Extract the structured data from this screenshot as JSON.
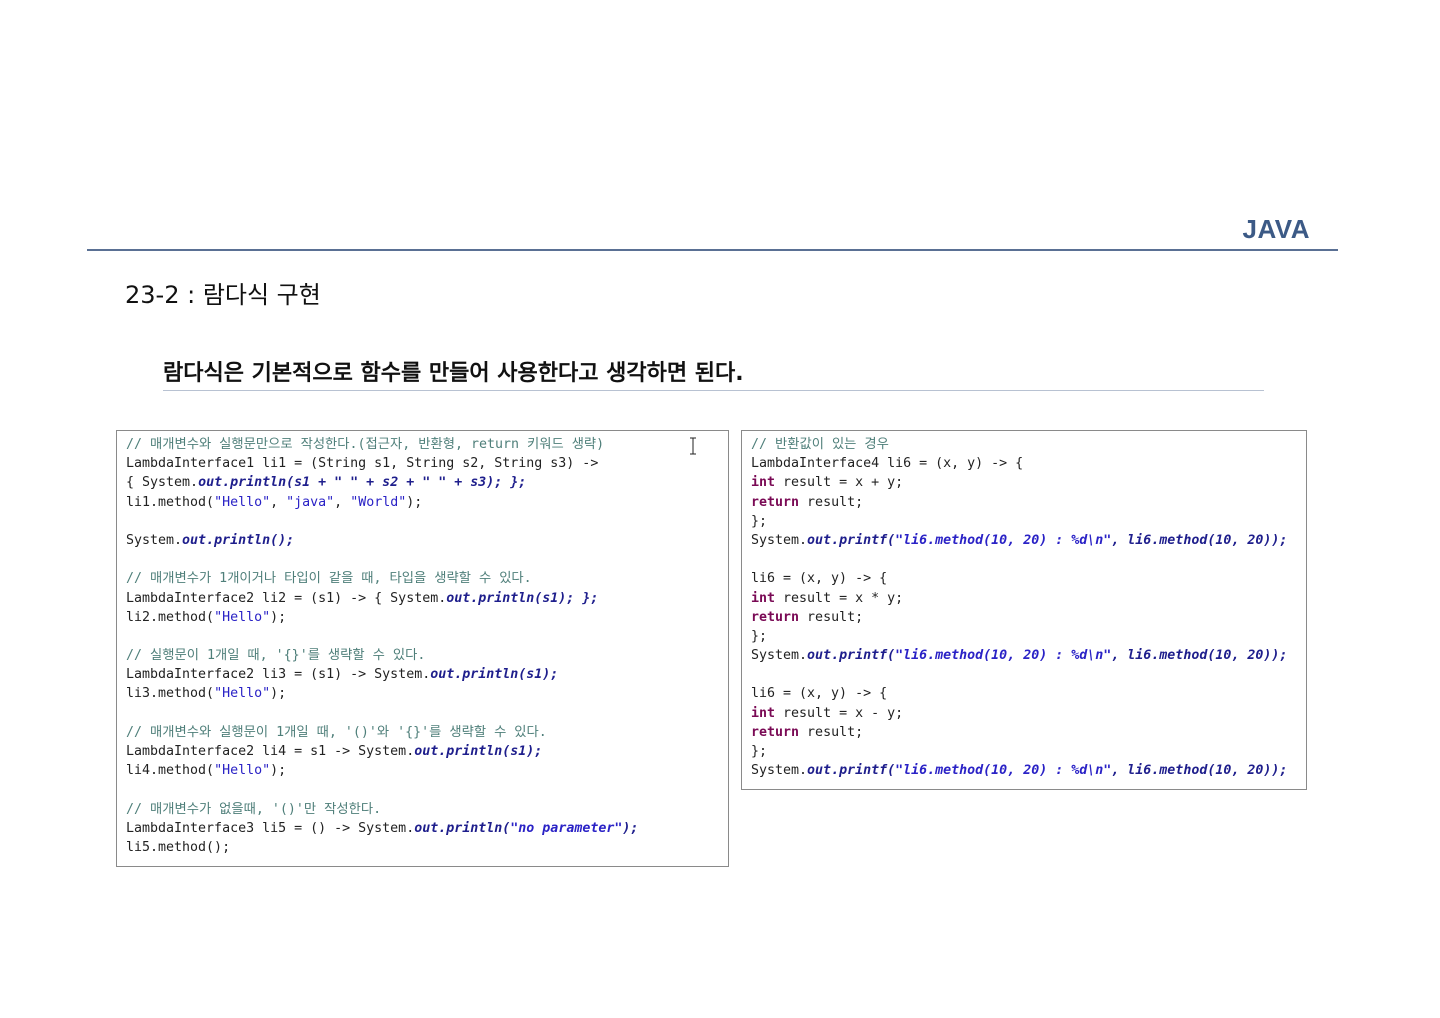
{
  "header": {
    "brand": "JAVA"
  },
  "section_title": "23-2 : 람다식 구현",
  "subtitle": "람다식은 기본적으로 함수를 만들어 사용한다고 생각하면 된다.",
  "left_code": [
    [
      {
        "t": "cm",
        "v": "// 매개변수와 실행문만으로 작성한다.(접근자, 반환형, return 키워드 생략)"
      }
    ],
    [
      {
        "t": "",
        "v": "LambdaInterface1 li1 = (String s1, String s2, String s3) ->"
      }
    ],
    [
      {
        "t": "",
        "v": "{ System."
      },
      {
        "t": "it",
        "v": "out.println(s1 + \" \" + s2 + \" \" + s3); };"
      }
    ],
    [
      {
        "t": "",
        "v": "li1.method("
      },
      {
        "t": "st",
        "v": "\"Hello\""
      },
      {
        "t": "",
        "v": ", "
      },
      {
        "t": "st",
        "v": "\"java\""
      },
      {
        "t": "",
        "v": ", "
      },
      {
        "t": "st",
        "v": "\"World\""
      },
      {
        "t": "",
        "v": ");"
      }
    ],
    [],
    [
      {
        "t": "",
        "v": "System."
      },
      {
        "t": "it",
        "v": "out.println();"
      }
    ],
    [],
    [
      {
        "t": "cm",
        "v": "// 매개변수가 1개이거나 타입이 같을 때, 타입을 생략할 수 있다."
      }
    ],
    [
      {
        "t": "",
        "v": "LambdaInterface2 li2 = (s1) -> { System."
      },
      {
        "t": "it",
        "v": "out.println(s1); };"
      }
    ],
    [
      {
        "t": "",
        "v": "li2.method("
      },
      {
        "t": "st",
        "v": "\"Hello\""
      },
      {
        "t": "",
        "v": ");"
      }
    ],
    [],
    [
      {
        "t": "cm",
        "v": "// 실행문이 1개일 때, '{}'를 생략할 수 있다."
      }
    ],
    [
      {
        "t": "",
        "v": "LambdaInterface2 li3 = (s1) -> System."
      },
      {
        "t": "it",
        "v": "out.println(s1);"
      }
    ],
    [
      {
        "t": "",
        "v": "li3.method("
      },
      {
        "t": "st",
        "v": "\"Hello\""
      },
      {
        "t": "",
        "v": ");"
      }
    ],
    [],
    [
      {
        "t": "cm",
        "v": "// 매개변수와 실행문이 1개일 때, '()'와 '{}'를 생략할 수 있다."
      }
    ],
    [
      {
        "t": "",
        "v": "LambdaInterface2 li4 = s1 -> System."
      },
      {
        "t": "it",
        "v": "out.println(s1);"
      }
    ],
    [
      {
        "t": "",
        "v": "li4.method("
      },
      {
        "t": "st",
        "v": "\"Hello\""
      },
      {
        "t": "",
        "v": ");"
      }
    ],
    [],
    [
      {
        "t": "cm",
        "v": "// 매개변수가 없을때, '()'만 작성한다."
      }
    ],
    [
      {
        "t": "",
        "v": "LambdaInterface3 li5 = () -> System."
      },
      {
        "t": "it",
        "v": "out.println("
      },
      {
        "t": "sti",
        "v": "\"no parameter\""
      },
      {
        "t": "it",
        "v": ");"
      }
    ],
    [
      {
        "t": "",
        "v": "li5.method();"
      }
    ]
  ],
  "right_code": [
    [
      {
        "t": "cm",
        "v": "// 반환값이 있는 경우"
      }
    ],
    [
      {
        "t": "",
        "v": "LambdaInterface4 li6 = (x, y) -> {"
      }
    ],
    [
      {
        "t": "kw",
        "v": "int"
      },
      {
        "t": "",
        "v": " result = x + y;"
      }
    ],
    [
      {
        "t": "kw",
        "v": "return"
      },
      {
        "t": "",
        "v": " result;"
      }
    ],
    [
      {
        "t": "",
        "v": "};"
      }
    ],
    [
      {
        "t": "",
        "v": "System."
      },
      {
        "t": "it",
        "v": "out.printf("
      },
      {
        "t": "sti",
        "v": "\"li6.method(10, 20) : %d\\n\""
      },
      {
        "t": "it",
        "v": ", li6.method(10, 20));"
      }
    ],
    [],
    [
      {
        "t": "",
        "v": "li6 = (x, y) -> {"
      }
    ],
    [
      {
        "t": "kw",
        "v": "int"
      },
      {
        "t": "",
        "v": " result = x * y;"
      }
    ],
    [
      {
        "t": "kw",
        "v": "return"
      },
      {
        "t": "",
        "v": " result;"
      }
    ],
    [
      {
        "t": "",
        "v": "};"
      }
    ],
    [
      {
        "t": "",
        "v": "System."
      },
      {
        "t": "it",
        "v": "out.printf("
      },
      {
        "t": "sti",
        "v": "\"li6.method(10, 20) : %d\\n\""
      },
      {
        "t": "it",
        "v": ", li6.method(10, 20));"
      }
    ],
    [],
    [
      {
        "t": "",
        "v": "li6 = (x, y) -> {"
      }
    ],
    [
      {
        "t": "kw",
        "v": "int"
      },
      {
        "t": "",
        "v": " result = x - y;"
      }
    ],
    [
      {
        "t": "kw",
        "v": "return"
      },
      {
        "t": "",
        "v": " result;"
      }
    ],
    [
      {
        "t": "",
        "v": "};"
      }
    ],
    [
      {
        "t": "",
        "v": "System."
      },
      {
        "t": "it",
        "v": "out.printf("
      },
      {
        "t": "sti",
        "v": "\"li6.method(10, 20) : %d\\n\""
      },
      {
        "t": "it",
        "v": ", li6.method(10, 20));"
      }
    ]
  ],
  "colors": {
    "brand": "#3c5a86",
    "rule": "#5a7094",
    "comment": "#4f7f7a",
    "string": "#2a22c6",
    "keyword": "#7a0a55"
  }
}
